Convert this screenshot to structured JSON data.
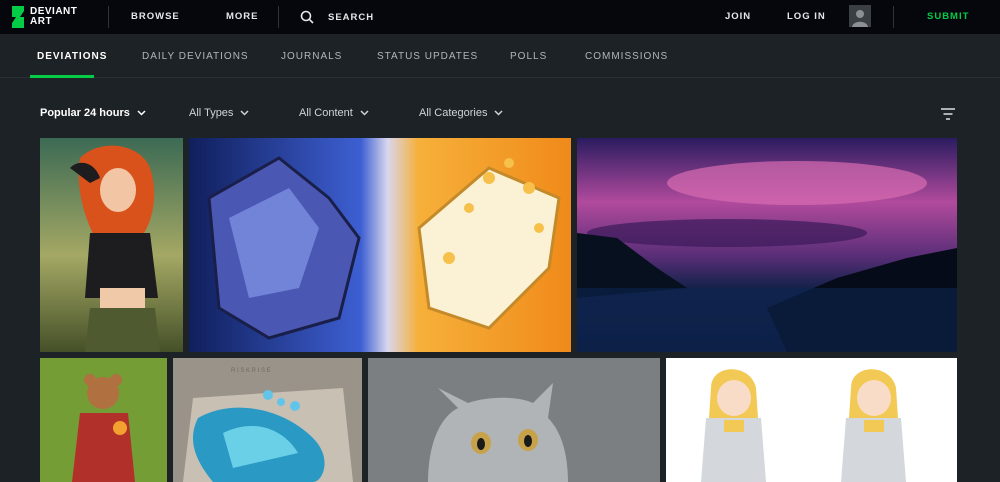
{
  "header": {
    "logo": {
      "text_line1": "DEVIANT",
      "text_line2": "ART",
      "icon": "deviantart-logo-icon"
    },
    "nav": {
      "browse": "BROWSE",
      "more": "MORE"
    },
    "search": {
      "placeholder": "SEARCH",
      "icon": "search-icon"
    },
    "join": "JOIN",
    "login": "LOG IN",
    "avatar_icon": "user-avatar-icon",
    "submit": "SUBMIT",
    "accent_color": "#05cc47"
  },
  "tabs": [
    {
      "label": "DEVIATIONS",
      "active": true
    },
    {
      "label": "DAILY DEVIATIONS",
      "active": false
    },
    {
      "label": "JOURNALS",
      "active": false
    },
    {
      "label": "STATUS UPDATES",
      "active": false
    },
    {
      "label": "POLLS",
      "active": false
    },
    {
      "label": "COMMISSIONS",
      "active": false
    }
  ],
  "filters": {
    "sort": "Popular 24 hours",
    "types": "All Types",
    "content": "All Content",
    "categories": "All Categories",
    "options_icon": "filter-lines-icon"
  },
  "gallery": [
    {
      "id": "redhead-heroine"
    },
    {
      "id": "fire-ice-dragons"
    },
    {
      "id": "purple-sky-lake"
    },
    {
      "id": "forest-bear-girl"
    },
    {
      "id": "blue-dragon-book",
      "text": "R I S K   R I S E"
    },
    {
      "id": "gray-kitten"
    },
    {
      "id": "twin-anime-girls"
    }
  ]
}
